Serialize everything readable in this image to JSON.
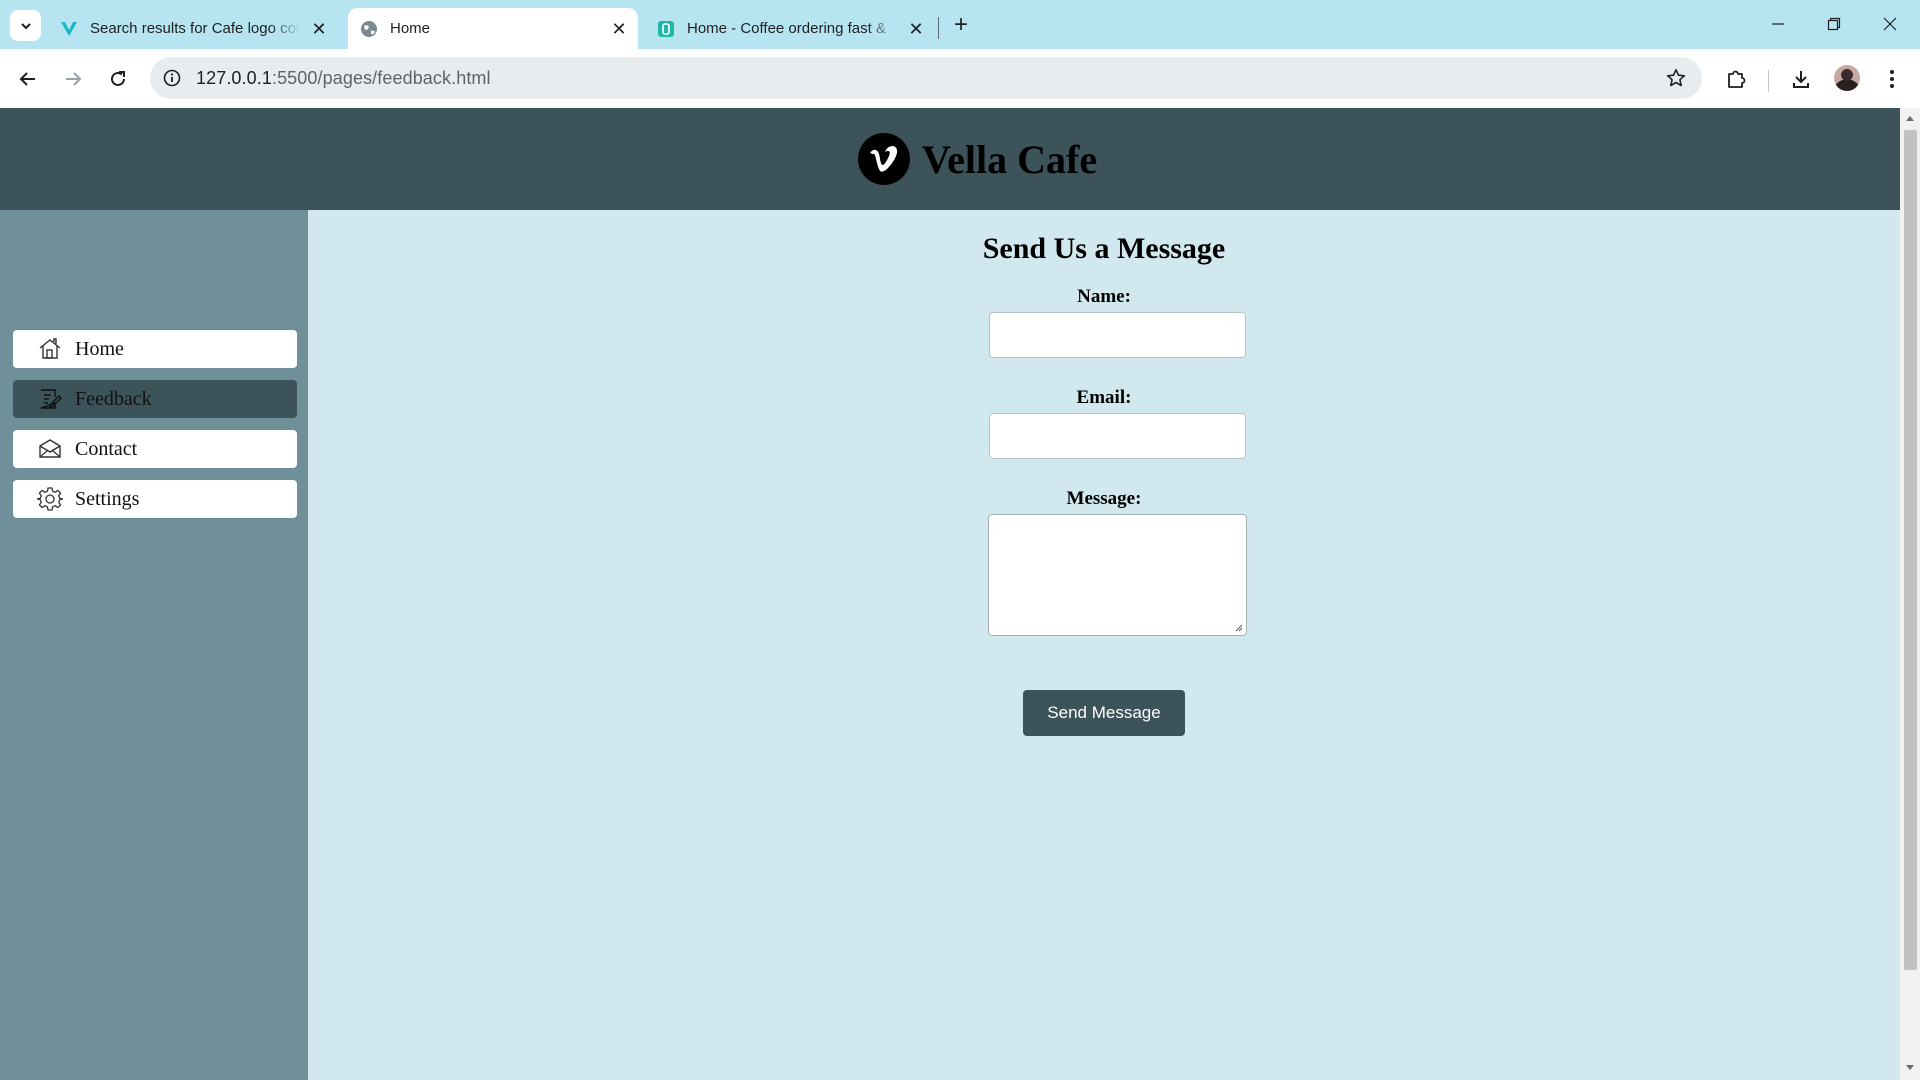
{
  "browser": {
    "tabs": [
      {
        "title": "Search results for Cafe logo col",
        "favicon": "vectorizer-v-icon",
        "active": false
      },
      {
        "title": "Home",
        "favicon": "globe-icon",
        "active": true
      },
      {
        "title": "Home - Coffee ordering fast &",
        "favicon": "app-tile-icon",
        "active": false
      }
    ],
    "url_host": "127.0.0.1",
    "url_rest": ":5500/pages/feedback.html"
  },
  "site": {
    "brand": "Vella Cafe",
    "logo_letter": "V",
    "colors": {
      "header": "#3c535a",
      "sidebar": "#6f9098",
      "content": "#d0e8ee",
      "button": "#3c535a"
    }
  },
  "sidebar": {
    "items": [
      {
        "label": "Home",
        "icon": "house-icon",
        "active": false
      },
      {
        "label": "Feedback",
        "icon": "feedback-icon",
        "active": true
      },
      {
        "label": "Contact",
        "icon": "envelope-icon",
        "active": false
      },
      {
        "label": "Settings",
        "icon": "gear-icon",
        "active": false
      }
    ]
  },
  "form": {
    "title": "Send Us a Message",
    "name_label": "Name:",
    "name_value": "",
    "email_label": "Email:",
    "email_value": "",
    "message_label": "Message:",
    "message_value": "",
    "submit_label": "Send Message"
  }
}
